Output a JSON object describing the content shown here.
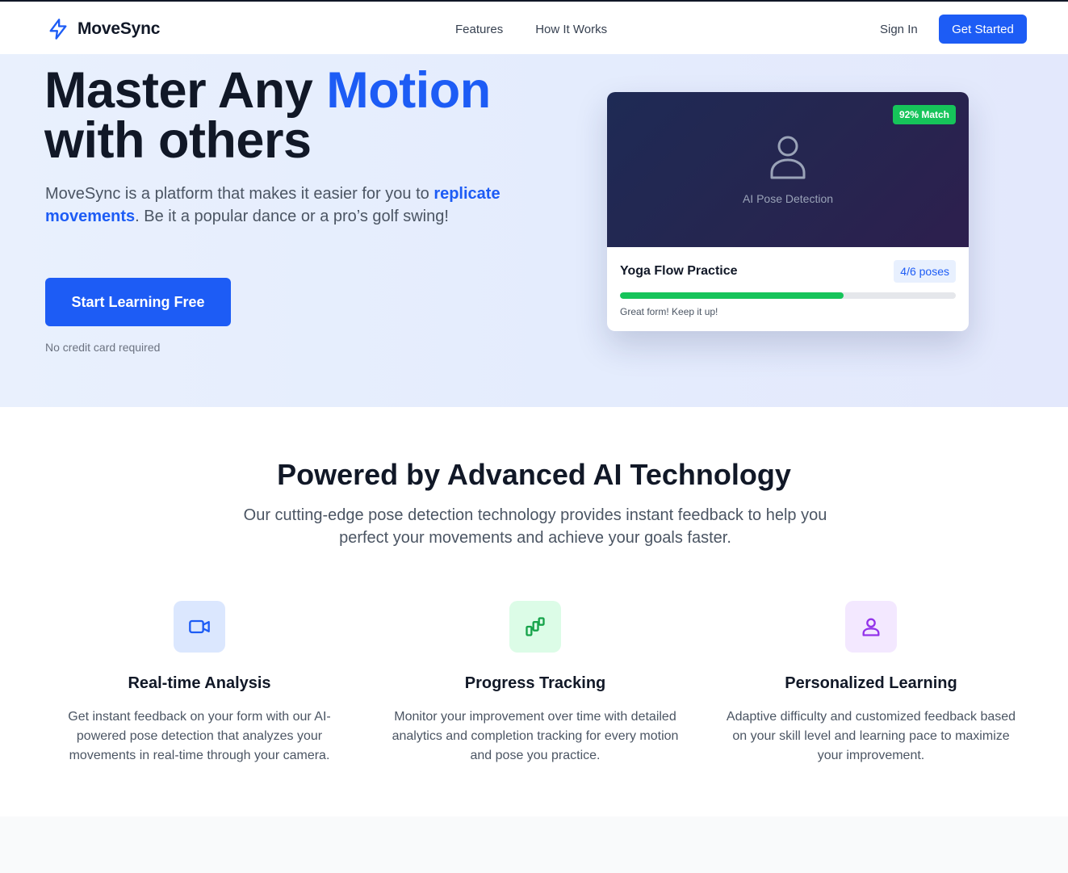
{
  "nav": {
    "brand": "MoveSync",
    "links": [
      "Features",
      "How It Works"
    ],
    "sign_in": "Sign In",
    "get_started": "Get Started"
  },
  "hero": {
    "title_part1": "Master Any ",
    "title_accent": "Motion",
    "title_part2": "with others",
    "desc_part1": "MoveSync is a platform that makes it easier for you to ",
    "desc_highlight": "replicate movements",
    "desc_part2": ". Be it a popular dance or a pro’s golf swing!",
    "cta": "Start Learning Free",
    "note": "No credit card required"
  },
  "demo_card": {
    "match_badge": "92% Match",
    "detection_label": "AI Pose Detection",
    "title": "Yoga Flow Practice",
    "poses_badge": "4/6 poses",
    "progress": 0.667,
    "feedback": "Great form! Keep it up!"
  },
  "features_section": {
    "title": "Powered by Advanced AI Technology",
    "subtitle": "Our cutting-edge pose detection technology provides instant feedback to help you perfect your movements and achieve your goals faster.",
    "items": [
      {
        "icon": "video-camera-icon",
        "title": "Real-time Analysis",
        "desc": "Get instant feedback on your form with our AI-powered pose detection that analyzes your movements in real-time through your camera.",
        "color": "#1d5cf5",
        "bg": "#dbe7fe"
      },
      {
        "icon": "progress-chart-icon",
        "title": "Progress Tracking",
        "desc": "Monitor your improvement over time with detailed analytics and completion tracking for every motion and pose you practice.",
        "color": "#16a34a",
        "bg": "#dcfce7"
      },
      {
        "icon": "user-icon",
        "title": "Personalized Learning",
        "desc": "Adaptive difficulty and customized feedback based on your skill level and learning pace to maximize your improvement.",
        "color": "#9333ea",
        "bg": "#f3e8ff"
      }
    ]
  },
  "colors": {
    "accent": "#1d5cf5",
    "success": "#16c45a"
  }
}
